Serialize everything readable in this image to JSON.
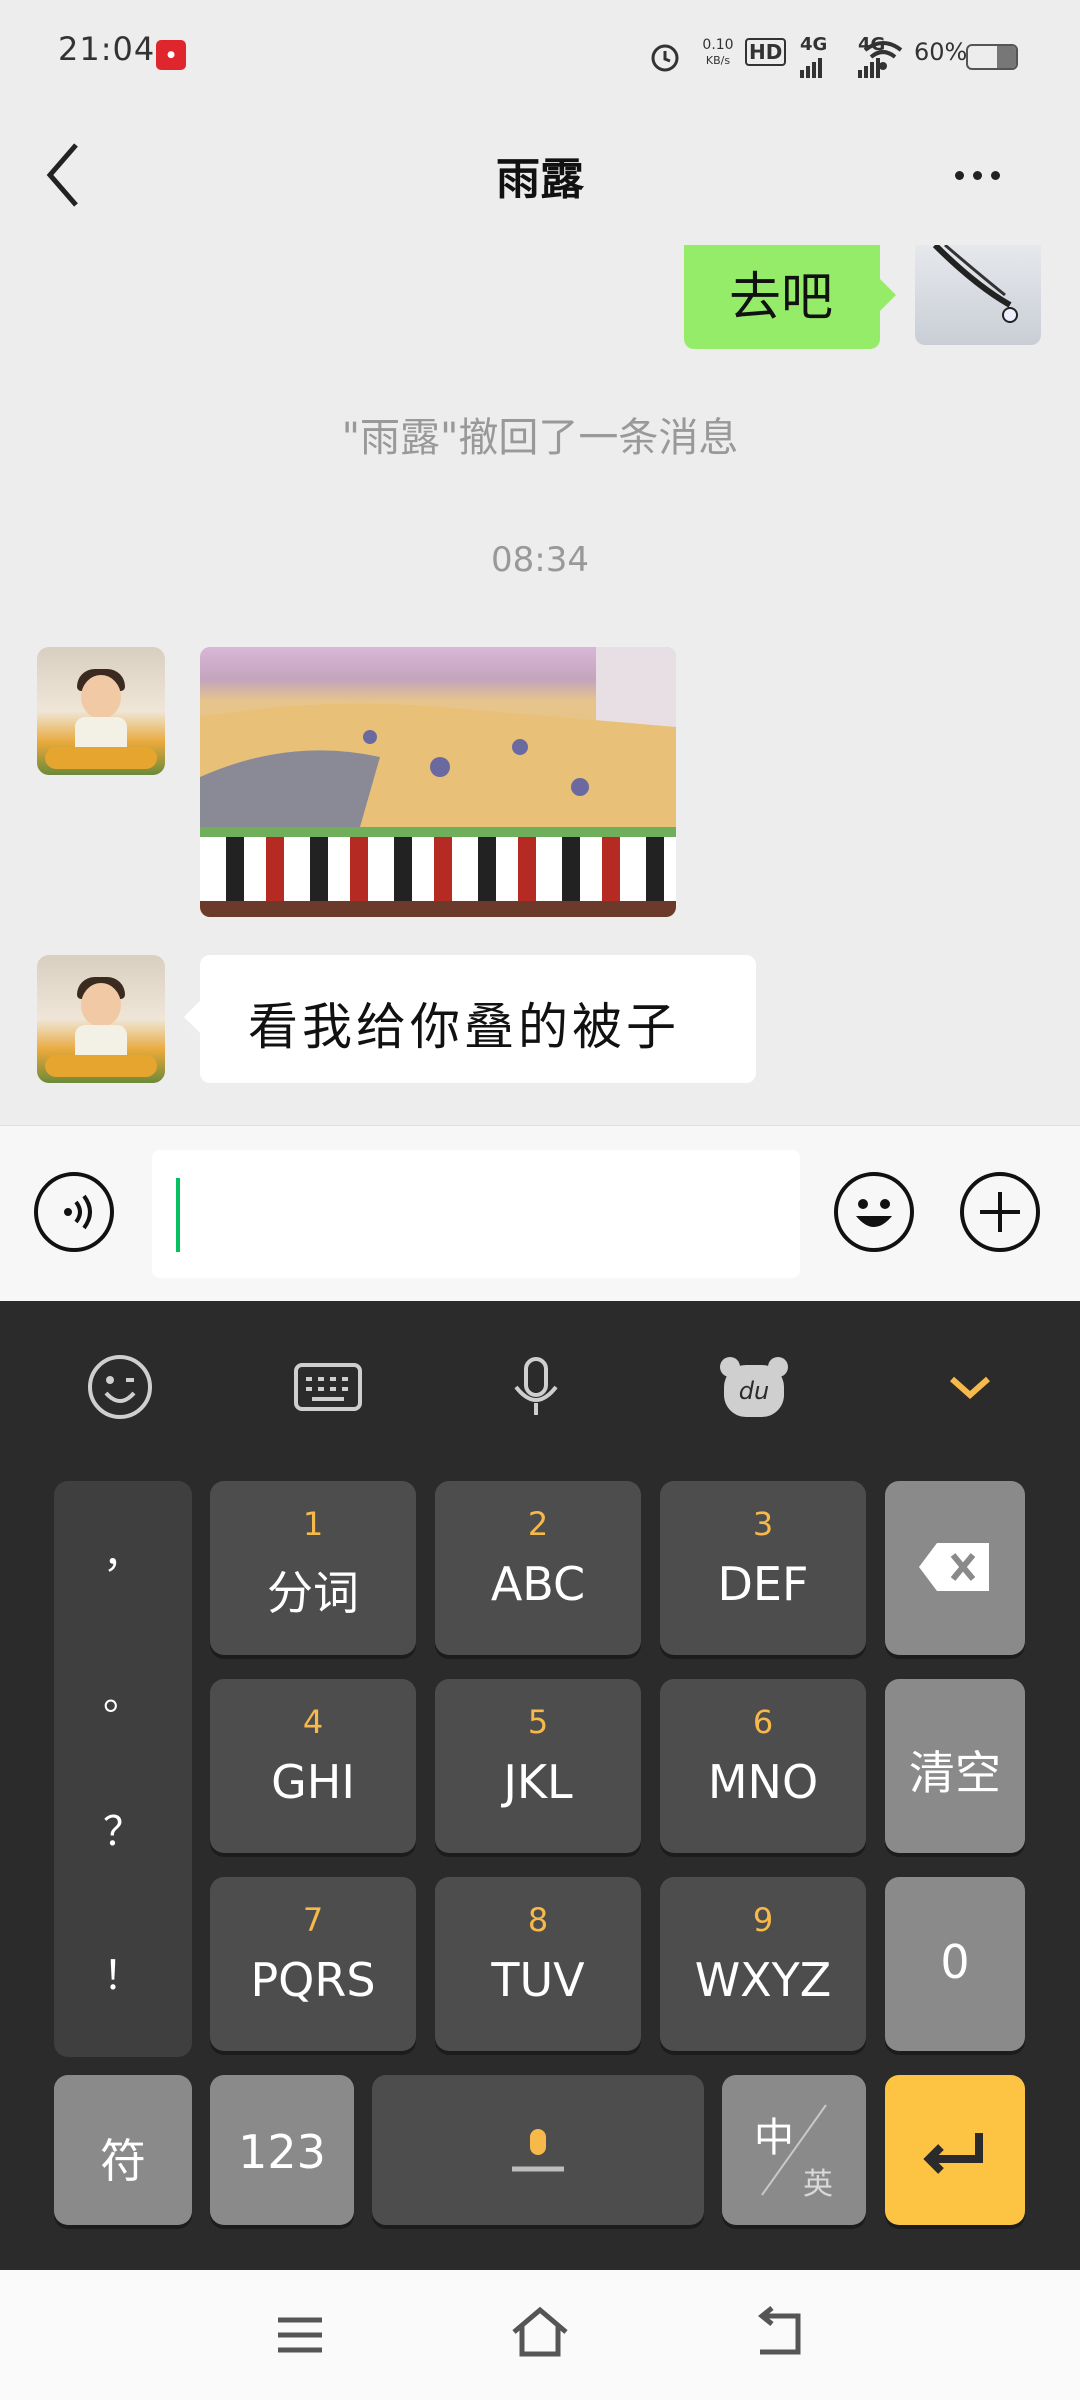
{
  "status_bar": {
    "time": "21:04",
    "notification_icon": "red-app-badge",
    "alarm_icon": "alarm-clock-icon",
    "net_speed_value": "0.10",
    "net_speed_unit": "KB/s",
    "hd_label": "HD",
    "sim1_label": "4G",
    "sim2_label": "4G",
    "wifi_icon": "wifi-icon",
    "battery_text": "60%",
    "battery_level": 0.6
  },
  "header": {
    "back_icon": "chevron-left-icon",
    "title": "雨露",
    "more_icon": "more-dots-icon"
  },
  "chat": {
    "my_message": "去吧",
    "recall_notice": "\"雨露\"撤回了一条消息",
    "timestamp": "08:34",
    "photo_message": "bed-with-folded-quilt-photo",
    "text_message": "看我给你叠的被子"
  },
  "input_bar": {
    "voice_icon": "voice-input-icon",
    "input_value": "",
    "emoji_icon": "smiley-icon",
    "plus_icon": "plus-icon"
  },
  "keyboard": {
    "toolbar": [
      "emoji-icon",
      "keyboard-icon",
      "microphone-icon",
      "du-bear-icon",
      "collapse-chevron-icon"
    ],
    "accent_color": "#f6b94a",
    "punct_column": [
      "，",
      "。",
      "？",
      "！"
    ],
    "keys": [
      {
        "num": "1",
        "label": "分词"
      },
      {
        "num": "2",
        "label": "ABC"
      },
      {
        "num": "3",
        "label": "DEF"
      },
      {
        "num": "4",
        "label": "GHI"
      },
      {
        "num": "5",
        "label": "JKL"
      },
      {
        "num": "6",
        "label": "MNO"
      },
      {
        "num": "7",
        "label": "PQRS"
      },
      {
        "num": "8",
        "label": "TUV"
      },
      {
        "num": "9",
        "label": "WXYZ"
      }
    ],
    "backspace_icon": "backspace-icon",
    "clear_label": "清空",
    "zero_label": "0",
    "symbol_label": "符",
    "num_label": "123",
    "space_icon": "space-mic-icon",
    "lang_main": "中",
    "lang_sub": "英",
    "enter_icon": "enter-icon",
    "enter_color": "#fdc444"
  },
  "nav_bar": {
    "menu_icon": "menu-icon",
    "home_icon": "home-icon",
    "back_icon": "back-icon"
  }
}
